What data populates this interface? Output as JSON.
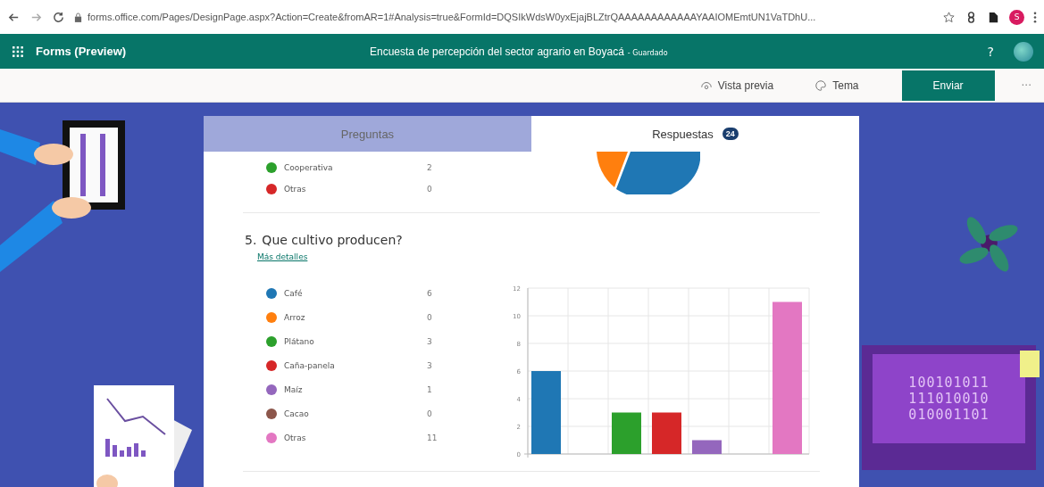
{
  "browser": {
    "url": "forms.office.com/Pages/DesignPage.aspx?Action=Create&fromAR=1#Analysis=true&FormId=DQSIkWdsW0yxEjajBLZtrQAAAAAAAAAAAAYAAIOMEmtUN1VaTDhU...",
    "profile": "S"
  },
  "app_bar": {
    "app_name": "Forms (Preview)",
    "form_title": "Encuesta de percepción del sector agrario en Boyacá",
    "save_status": "- Guardado",
    "help": "?"
  },
  "toolbar": {
    "preview": "Vista previa",
    "theme": "Tema",
    "send": "Enviar",
    "more": "···"
  },
  "tabs": [
    {
      "label": "Preguntas",
      "selected": false
    },
    {
      "label": "Respuestas",
      "selected": true,
      "badge": "24"
    }
  ],
  "previous_question": {
    "options": [
      {
        "label": "Cooperativa",
        "count": "2",
        "color": "#2ca02c"
      },
      {
        "label": "Otras",
        "count": "0",
        "color": "#d62728"
      }
    ]
  },
  "question": {
    "number": "5.",
    "title": "Que cultivo producen?",
    "details_link": "Más detalles",
    "options": [
      {
        "label": "Café",
        "count": "6",
        "color": "#1f77b4"
      },
      {
        "label": "Arroz",
        "count": "0",
        "color": "#ff7f0e"
      },
      {
        "label": "Plátano",
        "count": "3",
        "color": "#2ca02c"
      },
      {
        "label": "Caña-panela",
        "count": "3",
        "color": "#d62728"
      },
      {
        "label": "Maíz",
        "count": "1",
        "color": "#9467bd"
      },
      {
        "label": "Cacao",
        "count": "0",
        "color": "#8c564b"
      },
      {
        "label": "Otras",
        "count": "11",
        "color": "#e377c2"
      }
    ],
    "chart_data": {
      "type": "bar",
      "grid": true,
      "values": [
        6,
        0,
        3,
        3,
        1,
        0,
        11
      ],
      "ylim": [
        0,
        12
      ],
      "yticks": [
        0,
        2,
        4,
        6,
        8,
        10,
        12
      ]
    }
  },
  "decor": {
    "monitor_lines": [
      "100101011",
      "111010010",
      "010001101"
    ]
  }
}
